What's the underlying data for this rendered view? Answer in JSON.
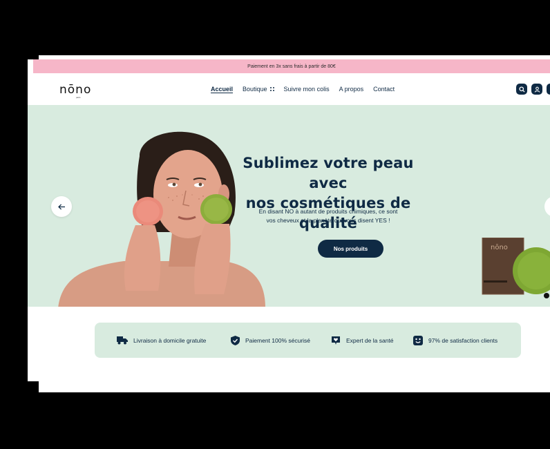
{
  "promo": {
    "text": "Paiement en 3x sans frais à partir de 80€"
  },
  "header": {
    "logo": "nōno",
    "logo_sub": "paris",
    "nav": [
      {
        "label": "Accueil",
        "active": true
      },
      {
        "label": "Boutique",
        "has_grid_icon": true
      },
      {
        "label": "Suivre mon colis"
      },
      {
        "label": "A propos"
      },
      {
        "label": "Contact"
      }
    ],
    "icons": [
      "search-icon",
      "account-icon",
      "cart-icon"
    ]
  },
  "hero": {
    "title_line1": "Sublimez votre peau avec",
    "title_line2": "nos cosmétiques de qualité",
    "subtitle_line1": "En disant NO à autant de produits chimiques, ce sont",
    "subtitle_line2": "vos cheveux et la planète qui vous disent YES !",
    "cta": "Nos produits",
    "product_brand": "nōno"
  },
  "features": [
    {
      "icon": "truck-icon",
      "label": "Livraison à domicile gratuite"
    },
    {
      "icon": "shield-check-icon",
      "label": "Paiement 100% sécurisé"
    },
    {
      "icon": "heart-badge-icon",
      "label": "Expert de la santé"
    },
    {
      "icon": "smiley-icon",
      "label": "97% de satisfaction clients"
    }
  ],
  "colors": {
    "navy": "#0f2a44",
    "mint": "#d8ebdf",
    "pink": "#f6b6c8"
  }
}
